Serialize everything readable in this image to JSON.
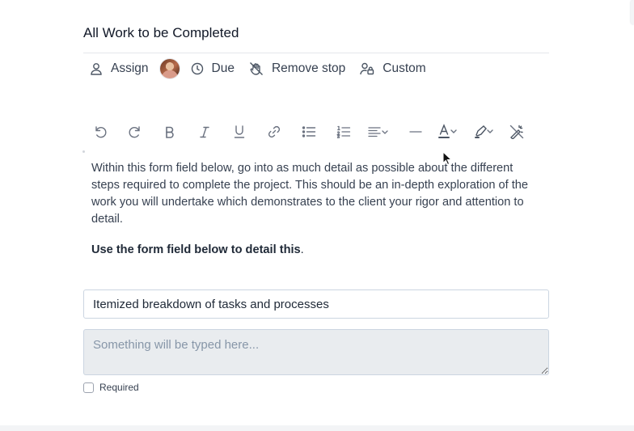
{
  "task": {
    "title": "All Work to be Completed"
  },
  "meta": {
    "assign_label": "Assign",
    "due_label": "Due",
    "remove_stop_label": "Remove stop",
    "custom_label": "Custom"
  },
  "toolbar": {
    "icons": [
      "undo-icon",
      "redo-icon",
      "bold-icon",
      "italic-icon",
      "underline-icon",
      "link-icon",
      "bullet-list-icon",
      "numbered-list-icon",
      "align-dropdown-icon",
      "horizontal-rule-icon",
      "text-color-dropdown-icon",
      "highlight-dropdown-icon",
      "clear-format-icon"
    ]
  },
  "content": {
    "description": "Within this form field below, go into as much detail as possible about the different steps required to complete the project. This should be an in-depth exploration of the work you will undertake which demonstrates to the client your rigor and attention to detail.",
    "instruction_bold": "Use the form field below to detail this",
    "instruction_tail": "."
  },
  "form": {
    "field_title_value": "Itemized breakdown of tasks and processes",
    "textarea_placeholder": "Something will be typed here...",
    "required_label": "Required"
  }
}
